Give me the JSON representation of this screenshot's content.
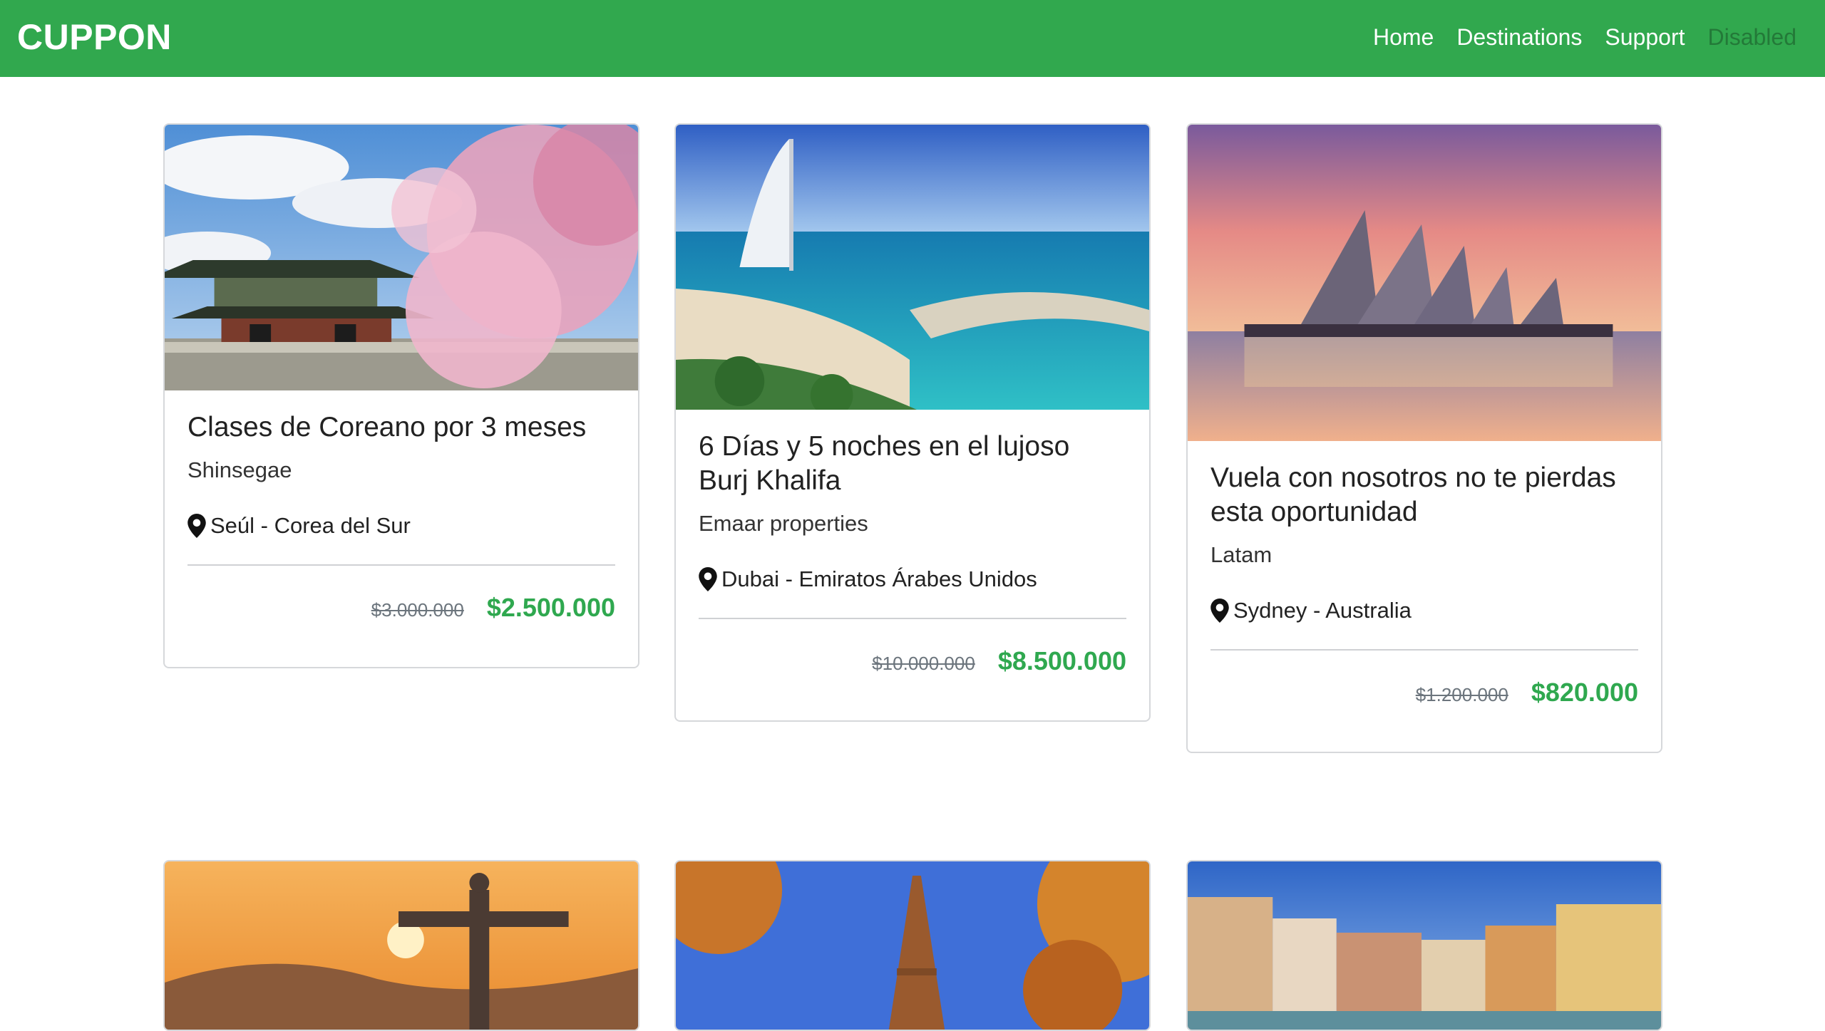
{
  "navbar": {
    "brand": "CUPPON",
    "links": [
      {
        "label": "Home"
      },
      {
        "label": "Destinations"
      },
      {
        "label": "Support"
      },
      {
        "label": "Disabled"
      }
    ]
  },
  "cards": [
    {
      "title": "Clases de Coreano por 3 meses",
      "company": "Shinsegae",
      "location": "Seúl - Corea del Sur",
      "old_price": "$3.000.000",
      "new_price": "$2.500.000"
    },
    {
      "title": "6 Días y 5 noches en el lujoso Burj Khalifa",
      "company": "Emaar properties",
      "location": "Dubai - Emiratos Árabes Unidos",
      "old_price": "$10.000.000",
      "new_price": "$8.500.000"
    },
    {
      "title": "Vuela con nosotros no te pierdas esta oportunidad",
      "company": "Latam",
      "location": "Sydney - Australia",
      "old_price": "$1.200.000",
      "new_price": "$820.000"
    }
  ],
  "colors": {
    "brand_green": "#31a84e",
    "price_green": "#2fa84f"
  },
  "icons": {
    "location": "map-pin-icon"
  }
}
